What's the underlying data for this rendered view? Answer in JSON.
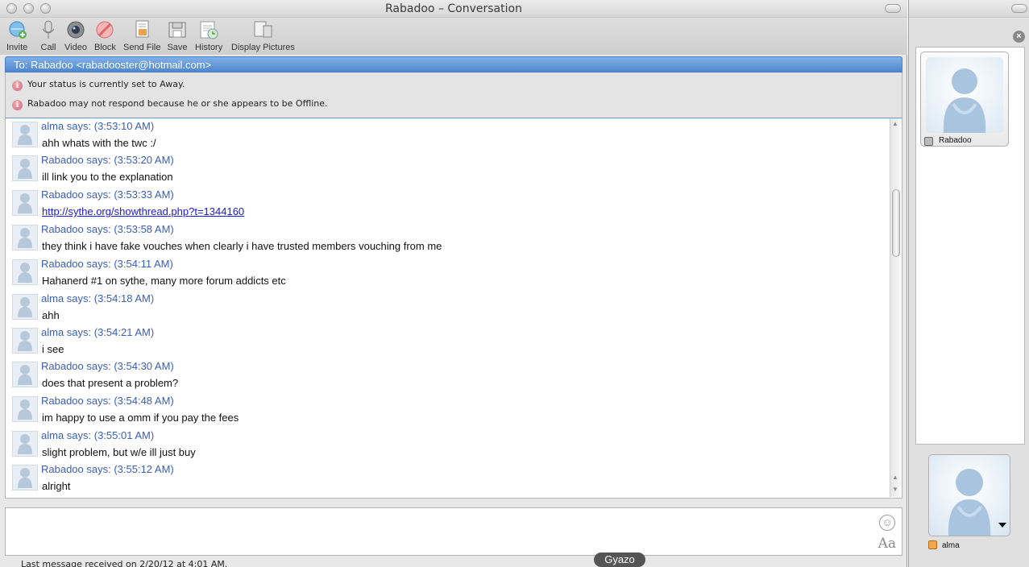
{
  "window": {
    "title": "Rabadoo – Conversation"
  },
  "toolbar": {
    "items": [
      {
        "label": "Invite",
        "icon": "invite-icon"
      },
      {
        "label": "Call",
        "icon": "microphone-icon"
      },
      {
        "label": "Video",
        "icon": "webcam-icon"
      },
      {
        "label": "Block",
        "icon": "block-icon"
      },
      {
        "label": "Send File",
        "icon": "send-file-icon"
      },
      {
        "label": "Save",
        "icon": "save-icon"
      },
      {
        "label": "History",
        "icon": "history-icon"
      },
      {
        "label": "Display Pictures",
        "icon": "display-pictures-icon"
      }
    ]
  },
  "conversation": {
    "to": "To: Rabadoo <rabadooster@hotmail.com>",
    "notices": [
      "Your status is currently set to Away.",
      "Rabadoo may not respond because he or she appears to be Offline."
    ],
    "messages": [
      {
        "header": "alma says: (3:53:10 AM)",
        "text": "ahh whats with the twc :/",
        "link": ""
      },
      {
        "header": "Rabadoo says: (3:53:20 AM)",
        "text": "ill link you to the explanation",
        "link": ""
      },
      {
        "header": "Rabadoo says: (3:53:33 AM)",
        "text": "",
        "link": "http://sythe.org/showthread.php?t=1344160"
      },
      {
        "header": "Rabadoo says: (3:53:58 AM)",
        "text": "they think i have fake vouches when clearly i have trusted members vouching from me",
        "link": ""
      },
      {
        "header": "Rabadoo says: (3:54:11 AM)",
        "text": "Hahanerd #1 on sythe, many more forum addicts etc",
        "link": ""
      },
      {
        "header": "alma says: (3:54:18 AM)",
        "text": "ahh",
        "link": ""
      },
      {
        "header": "alma says: (3:54:21 AM)",
        "text": "i see",
        "link": ""
      },
      {
        "header": "Rabadoo says: (3:54:30 AM)",
        "text": "does that present a problem?",
        "link": ""
      },
      {
        "header": "Rabadoo says: (3:54:48 AM)",
        "text": "im happy to use a omm if you pay the fees",
        "link": ""
      },
      {
        "header": "alma says: (3:55:01 AM)",
        "text": "slight problem, but w/e ill just buy",
        "link": ""
      },
      {
        "header": "Rabadoo says: (3:55:12 AM)",
        "text": "alright",
        "link": ""
      }
    ]
  },
  "input": {
    "value": "",
    "font_button": "Aa"
  },
  "statusbar": {
    "text": "Last message received on 2/20/12 at 4:01 AM."
  },
  "gyazo": {
    "label": "Gyazo"
  },
  "side_panel": {
    "contact_name": "Rabadoo",
    "self_name": "alma"
  },
  "colors": {
    "header_blue": "#3a5fb8",
    "to_bar": "#5b90d4",
    "link": "#1a1ad8",
    "notice_icon": "#d06974"
  }
}
